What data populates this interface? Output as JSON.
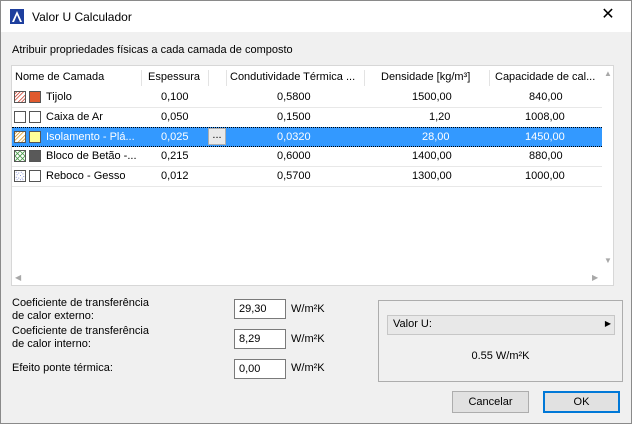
{
  "window": {
    "title": "Valor U Calculador",
    "close_glyph": "✕"
  },
  "header_text": "Atribuir propriedades físicas a cada camada de composto",
  "table": {
    "columns": [
      "Nome de Camada",
      "Espessura",
      "Condutividade Térmica ...",
      "Densidade [kg/m³]",
      "Capacidade de cal..."
    ],
    "rows": [
      {
        "name": "Tijolo",
        "espessura": "0,100",
        "condutividade": "0,5800",
        "densidade": "1500,00",
        "capacidade": "840,00",
        "hatch": "diagonal-red",
        "color": "#e05a2e"
      },
      {
        "name": "Caixa de Ar",
        "espessura": "0,050",
        "condutividade": "0,1500",
        "densidade": "1,20",
        "capacidade": "1008,00",
        "hatch": "none",
        "color": "#ffffff"
      },
      {
        "name": "Isolamento - Plá...",
        "espessura": "0,025",
        "condutividade": "0,0320",
        "densidade": "28,00",
        "capacidade": "1450,00",
        "hatch": "diagonal-orange",
        "color": "#ffff99",
        "selected": true,
        "dots_label": "..."
      },
      {
        "name": "Bloco de Betão -...",
        "espessura": "0,215",
        "condutividade": "0,6000",
        "densidade": "1400,00",
        "capacidade": "880,00",
        "hatch": "cross-green",
        "color": "#595959"
      },
      {
        "name": "Reboco - Gesso",
        "espessura": "0,012",
        "condutividade": "0,5700",
        "densidade": "1300,00",
        "capacidade": "1000,00",
        "hatch": "dots-blue",
        "color": "#ffffff"
      }
    ]
  },
  "fields": {
    "external": {
      "label_line1": "Coeficiente de transferência",
      "label_line2": "de calor externo:",
      "value": "29,30",
      "unit": "W/m²K"
    },
    "internal": {
      "label_line1": "Coeficiente de transferência",
      "label_line2": "de calor interno:",
      "value": "8,29",
      "unit": "W/m²K"
    },
    "bridge": {
      "label": "Efeito ponte térmica:",
      "value": "0,00",
      "unit": "W/m²K"
    }
  },
  "result": {
    "label": "Valor U:",
    "value": "0.55  W/m²K"
  },
  "buttons": {
    "cancel": "Cancelar",
    "ok": "OK"
  },
  "icons": {
    "app": "archicad-app-icon",
    "scroll_up": "▲",
    "scroll_down": "▼",
    "scroll_left": "◀",
    "scroll_right": "▶",
    "expand": "▶"
  },
  "colors": {
    "selection": "#3399ff",
    "primary_border": "#0078d7"
  }
}
